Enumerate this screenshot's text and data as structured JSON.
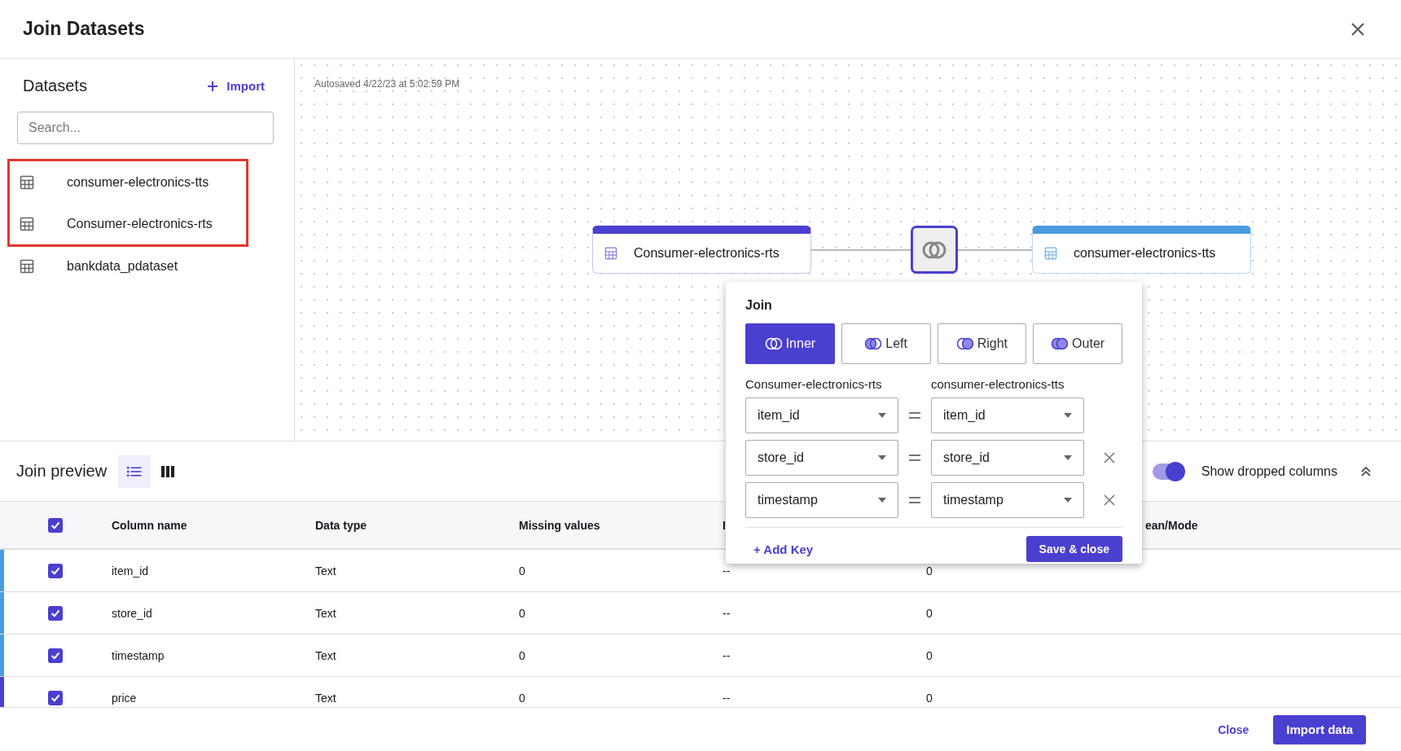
{
  "dialog": {
    "title": "Join Datasets"
  },
  "sidebar": {
    "title": "Datasets",
    "import_label": "Import",
    "search": {
      "placeholder": "Search..."
    },
    "items": [
      {
        "name": "consumer-electronics-tts",
        "highlighted": true
      },
      {
        "name": "Consumer-electronics-rts",
        "highlighted": true
      },
      {
        "name": "bankdata_pdataset",
        "highlighted": false
      }
    ]
  },
  "canvas": {
    "autosave": "Autosaved 4/22/23 at 5:02:59 PM",
    "left_node": {
      "name": "Consumer-electronics-rts",
      "color": "#4b3fcf"
    },
    "right_node": {
      "name": "consumer-electronics-tts",
      "color": "#4a9be0"
    }
  },
  "join_popup": {
    "title": "Join",
    "types": [
      {
        "label": "Inner",
        "selected": true
      },
      {
        "label": "Left",
        "selected": false
      },
      {
        "label": "Right",
        "selected": false
      },
      {
        "label": "Outer",
        "selected": false
      }
    ],
    "left_dataset": "Consumer-electronics-rts",
    "right_dataset": "consumer-electronics-tts",
    "keys": [
      {
        "left": "item_id",
        "right": "item_id",
        "removable": false
      },
      {
        "left": "store_id",
        "right": "store_id",
        "removable": true
      },
      {
        "left": "timestamp",
        "right": "timestamp",
        "removable": true
      }
    ],
    "add_key": "+ Add Key",
    "save": "Save & close"
  },
  "preview": {
    "title": "Join preview",
    "views": [
      {
        "kind": "list",
        "selected": true
      },
      {
        "kind": "columns",
        "selected": false
      }
    ],
    "show_dropped": {
      "label": "Show dropped columns",
      "on": true
    },
    "table": {
      "all_checked": true,
      "columns": [
        {
          "label": "Column name"
        },
        {
          "label": "Data type"
        },
        {
          "label": "Missing values"
        },
        {
          "label": "I"
        },
        {},
        {
          "label": "ean/Mode"
        }
      ],
      "rows": [
        {
          "cells": [
            "item_id",
            "Text",
            "0",
            "--",
            "0"
          ],
          "checked": true,
          "color": "#4a9be0"
        },
        {
          "cells": [
            "store_id",
            "Text",
            "0",
            "--",
            "0"
          ],
          "checked": true,
          "color": "#4a9be0"
        },
        {
          "cells": [
            "timestamp",
            "Text",
            "0",
            "--",
            "0"
          ],
          "checked": true,
          "color": "#4a9be0"
        },
        {
          "cells": [
            "price",
            "Text",
            "0",
            "--",
            "0"
          ],
          "checked": true,
          "color": "#4b3fcf"
        }
      ]
    }
  },
  "footer": {
    "close": "Close",
    "import": "Import data"
  }
}
